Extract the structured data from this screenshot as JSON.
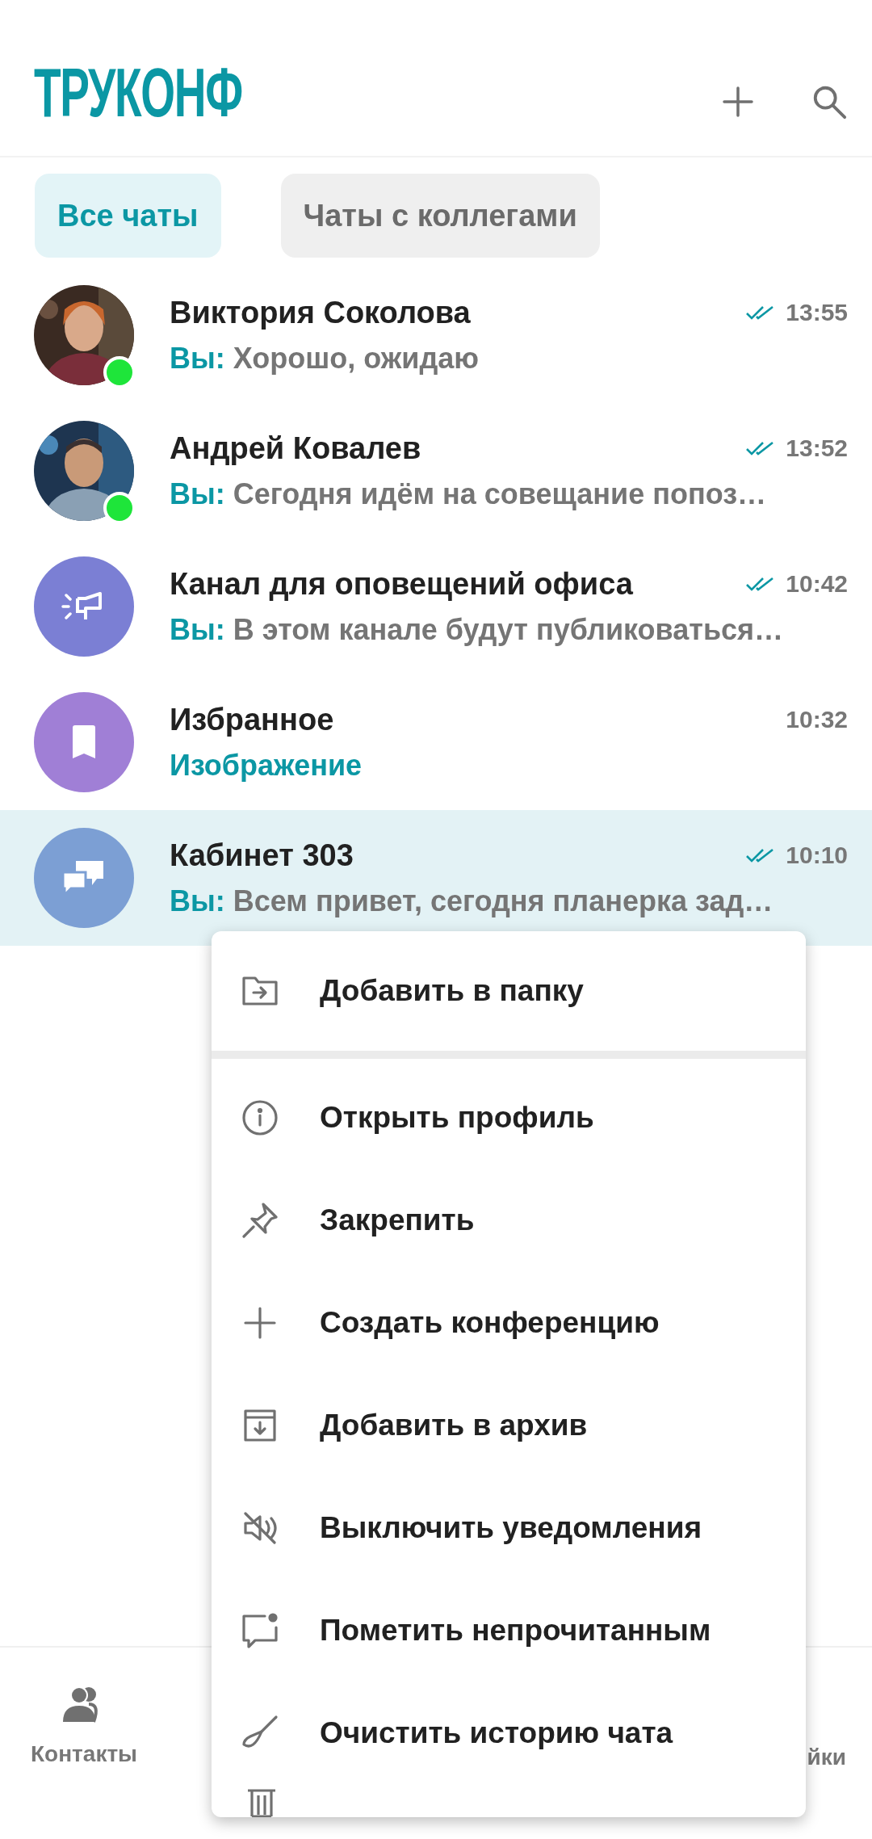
{
  "header": {
    "logo": "ТРУКОНФ"
  },
  "tabs": [
    {
      "label": "Все чаты",
      "selected": true
    },
    {
      "label": "Чаты с коллегами",
      "selected": false
    }
  ],
  "chats": [
    {
      "name": "Виктория Соколова",
      "kind": "picture",
      "online": true,
      "read": true,
      "time": "13:55",
      "sender": "Вы:",
      "text": "Хорошо, ожидаю",
      "selected": false
    },
    {
      "name": "Андрей Ковалев",
      "kind": "picture",
      "online": true,
      "read": true,
      "time": "13:52",
      "sender": "Вы:",
      "text": "Сегодня идём на совещание попоз…",
      "selected": false
    },
    {
      "name": "Канал для оповещений офиса",
      "kind": "channel",
      "color": "#7b7fd4",
      "online": false,
      "read": true,
      "time": "10:42",
      "sender": "Вы:",
      "text": "В этом канале будут публиковаться…",
      "selected": false
    },
    {
      "name": "Избранное",
      "kind": "bookmark",
      "color": "#a07fd6",
      "online": false,
      "read": false,
      "time": "10:32",
      "media": "Изображение",
      "selected": false
    },
    {
      "name": "Кабинет 303",
      "kind": "group",
      "color": "#7c9fd4",
      "online": false,
      "read": true,
      "time": "10:10",
      "sender": "Вы:",
      "text": "Всем привет, сегодня планерка зад…",
      "selected": true
    }
  ],
  "context_menu": [
    {
      "label": "Добавить в папку",
      "kind": "folder"
    },
    {
      "label": "Открыть профиль",
      "kind": "info"
    },
    {
      "label": "Закрепить",
      "kind": "pin"
    },
    {
      "label": "Создать конференцию",
      "kind": "plus"
    },
    {
      "label": "Добавить в архив",
      "kind": "archive"
    },
    {
      "label": "Выключить уведомления",
      "kind": "mute"
    },
    {
      "label": "Пометить непрочитанным",
      "kind": "unread"
    },
    {
      "label": "Очистить историю чата",
      "kind": "broom"
    }
  ],
  "bottom_nav": [
    {
      "label": "Контакты",
      "kind": "contacts"
    },
    {
      "label": "йки",
      "kind": "settings"
    }
  ]
}
